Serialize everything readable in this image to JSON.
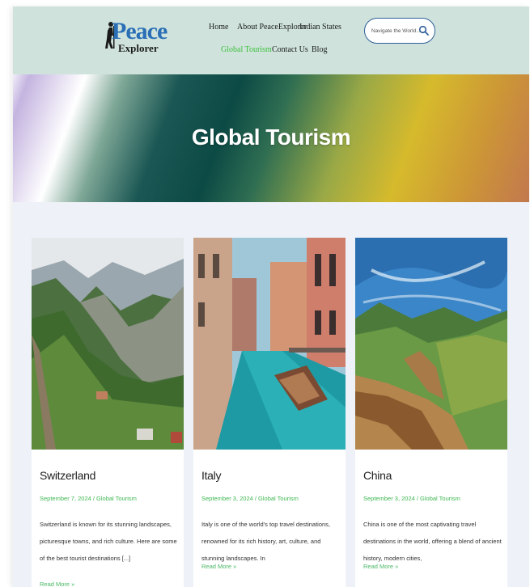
{
  "header": {
    "logo_word": "Peace",
    "logo_sub": "Explorer",
    "nav": [
      "Home",
      "About PeaceExplorer",
      "Indian States",
      "Global Tourism",
      "Contact Us",
      "Blog"
    ],
    "active_nav": "Global Tourism",
    "search_placeholder": "Navigate the World..."
  },
  "hero": {
    "title": "Global Tourism"
  },
  "posts": [
    {
      "title": "Switzerland",
      "meta": "September 7, 2024 / Global Tourism",
      "excerpt": "Switzerland is known for its stunning landscapes, picturesque towns, and rich culture. Here are some of the best tourist destinations [...]",
      "more": "Read More »"
    },
    {
      "title": "Italy",
      "meta": "September 3, 2024 / Global Tourism",
      "excerpt": "Italy is one of the world's top travel destinations, renowned for its rich history, art, culture, and stunning landscapes. In",
      "more": "Read More »"
    },
    {
      "title": "China",
      "meta": "September 3, 2024 / Global Tourism",
      "excerpt": "China is one of the most captivating travel destinations in the world, offering a blend of ancient history, modern cities,",
      "more": "Read More »"
    }
  ],
  "colors": {
    "header_bg": "#cfe3dc",
    "accent_green": "#3cbf3c",
    "logo_blue": "#2a6fb6"
  }
}
